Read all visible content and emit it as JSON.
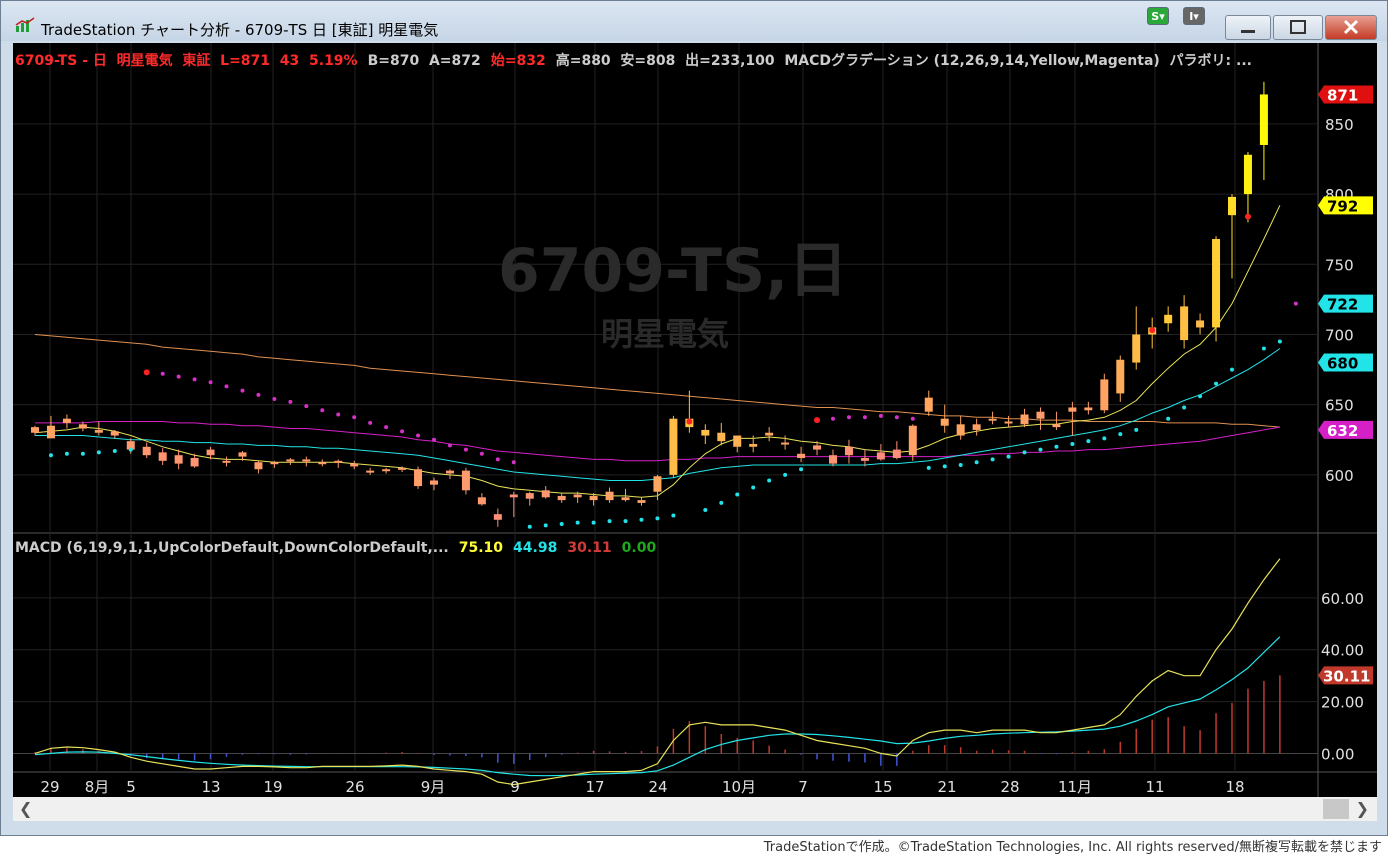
{
  "window": {
    "title": "TradeStation チャート分析 - 6709-TS 日 [東証] 明星電気",
    "s_button": "S",
    "i_button": "I",
    "copyright": "TradeStationで作成。©TradeStation Technologies, Inc. All rights reserved/無断複写転載を禁じます"
  },
  "header": {
    "symbol_info": "6709-TS - 日  明星電気  東証  L=871  43  5.19%",
    "ba_info": "B=870  A=872",
    "open_info": "始=832",
    "hl_info": "高=880  安=808  出=233,100  MACDグラデーション (12,26,9,14,Yellow,Magenta)  パラボリ: ..."
  },
  "watermark": {
    "symbol": "6709-TS,日",
    "name": "明星電気"
  },
  "macd_header": {
    "label": "MACD (6,19,9,1,1,UpColorDefault,DownColorDefault,...",
    "v1": "75.10",
    "v2": "44.98",
    "v3": "30.11",
    "v4": "0.00"
  },
  "colors": {
    "up": "#ffff00",
    "down": "#ff3bd4",
    "signal": "#22e3e8",
    "macd": "#e8e35a",
    "ma_long": "#e09050",
    "ma_mid": "#d520c8",
    "sar": "#22e3e8",
    "sar_red": "#ff2222"
  },
  "chart_data": [
    {
      "type": "candlestick",
      "ylim": [
        560,
        882
      ],
      "y_ticks": [
        600,
        650,
        700,
        750,
        800,
        850
      ],
      "x_labels": [
        "29",
        "8月",
        "5",
        "13",
        "19",
        "26",
        "9月",
        "9",
        "17",
        "24",
        "10月",
        "7",
        "15",
        "21",
        "28",
        "11月",
        "11",
        "18"
      ],
      "price_tags": [
        {
          "value": 871,
          "label": "871"
        },
        {
          "value": 792,
          "label": "792"
        },
        {
          "value": 722,
          "label": "722"
        },
        {
          "value": 680,
          "label": "680"
        },
        {
          "value": 632,
          "label": "632"
        }
      ],
      "candles": [
        [
          630,
          635,
          628,
          634
        ],
        [
          635,
          642,
          628,
          626
        ],
        [
          637,
          643,
          633,
          640
        ],
        [
          636,
          638,
          631,
          633
        ],
        [
          632,
          638,
          628,
          630
        ],
        [
          628,
          632,
          626,
          631
        ],
        [
          624,
          626,
          615,
          618
        ],
        [
          620,
          623,
          612,
          614
        ],
        [
          616,
          619,
          607,
          610
        ],
        [
          614,
          618,
          604,
          608
        ],
        [
          612,
          615,
          605,
          606
        ],
        [
          614,
          620,
          611,
          618
        ],
        [
          610,
          613,
          606,
          609
        ],
        [
          613,
          617,
          610,
          616
        ],
        [
          609,
          610,
          601,
          604
        ],
        [
          608,
          610,
          605,
          609
        ],
        [
          611,
          612,
          607,
          610
        ],
        [
          610,
          613,
          606,
          611
        ],
        [
          609,
          611,
          606,
          608
        ],
        [
          609,
          611,
          605,
          610
        ],
        [
          608,
          610,
          604,
          606
        ],
        [
          603,
          605,
          600,
          602
        ],
        [
          604,
          605,
          601,
          603
        ],
        [
          604,
          606,
          602,
          605
        ],
        [
          604,
          606,
          590,
          592
        ],
        [
          596,
          598,
          589,
          593
        ],
        [
          601,
          604,
          597,
          603
        ],
        [
          603,
          605,
          586,
          589
        ],
        [
          584,
          587,
          578,
          579
        ],
        [
          572,
          576,
          563,
          568
        ],
        [
          584,
          588,
          570,
          586
        ],
        [
          583,
          588,
          578,
          587
        ],
        [
          589,
          592,
          583,
          584
        ],
        [
          585,
          587,
          580,
          582
        ],
        [
          584,
          588,
          580,
          586
        ],
        [
          582,
          587,
          578,
          585
        ],
        [
          588,
          591,
          580,
          582
        ],
        [
          584,
          590,
          581,
          582
        ],
        [
          580,
          584,
          578,
          582
        ],
        [
          588,
          600,
          582,
          599
        ],
        [
          600,
          642,
          598,
          640
        ],
        [
          640,
          660,
          630,
          634
        ],
        [
          628,
          636,
          622,
          632
        ],
        [
          630,
          637,
          621,
          624
        ],
        [
          620,
          628,
          616,
          628
        ],
        [
          622,
          628,
          616,
          620
        ],
        [
          628,
          634,
          624,
          630
        ],
        [
          623,
          628,
          618,
          622
        ],
        [
          615,
          620,
          609,
          612
        ],
        [
          621,
          624,
          614,
          618
        ],
        [
          614,
          618,
          606,
          608
        ],
        [
          620,
          625,
          608,
          614
        ],
        [
          612,
          618,
          606,
          610
        ],
        [
          616,
          622,
          610,
          611
        ],
        [
          618,
          624,
          611,
          612
        ],
        [
          614,
          636,
          610,
          635
        ],
        [
          655,
          660,
          642,
          645
        ],
        [
          640,
          650,
          630,
          635
        ],
        [
          628,
          642,
          625,
          636
        ],
        [
          636,
          640,
          628,
          632
        ],
        [
          640,
          645,
          636,
          640
        ],
        [
          638,
          642,
          634,
          638
        ],
        [
          643,
          647,
          634,
          636
        ],
        [
          640,
          648,
          632,
          645
        ],
        [
          636,
          645,
          632,
          634
        ],
        [
          645,
          652,
          628,
          648
        ],
        [
          646,
          652,
          643,
          648
        ],
        [
          646,
          672,
          644,
          668
        ],
        [
          658,
          685,
          652,
          682
        ],
        [
          680,
          720,
          675,
          700
        ],
        [
          700,
          712,
          690,
          705
        ],
        [
          708,
          720,
          702,
          714
        ],
        [
          720,
          728,
          690,
          696
        ],
        [
          705,
          715,
          700,
          710
        ],
        [
          705,
          770,
          695,
          768
        ],
        [
          785,
          800,
          740,
          798
        ],
        [
          800,
          830,
          780,
          828
        ],
        [
          835,
          880,
          810,
          871
        ]
      ],
      "sar": [
        [
          1,
          614
        ],
        [
          2,
          615
        ],
        [
          3,
          615
        ],
        [
          4,
          616
        ],
        [
          5,
          617
        ],
        [
          6,
          618
        ],
        [
          7,
          673
        ],
        [
          8,
          672
        ],
        [
          9,
          670
        ],
        [
          10,
          668
        ],
        [
          11,
          666
        ],
        [
          12,
          663
        ],
        [
          13,
          660
        ],
        [
          14,
          657
        ],
        [
          15,
          654
        ],
        [
          16,
          652
        ],
        [
          17,
          649
        ],
        [
          18,
          646
        ],
        [
          19,
          643
        ],
        [
          20,
          641
        ],
        [
          21,
          637
        ],
        [
          22,
          634
        ],
        [
          23,
          631
        ],
        [
          24,
          628
        ],
        [
          25,
          625
        ],
        [
          26,
          621
        ],
        [
          27,
          618
        ],
        [
          28,
          615
        ],
        [
          29,
          611
        ],
        [
          30,
          609
        ],
        [
          31,
          563
        ],
        [
          32,
          564
        ],
        [
          33,
          565
        ],
        [
          34,
          566
        ],
        [
          35,
          566
        ],
        [
          36,
          567
        ],
        [
          37,
          567
        ],
        [
          38,
          568
        ],
        [
          39,
          569
        ],
        [
          40,
          571
        ],
        [
          41,
          638
        ],
        [
          42,
          575
        ],
        [
          43,
          580
        ],
        [
          44,
          586
        ],
        [
          45,
          591
        ],
        [
          46,
          596
        ],
        [
          47,
          600
        ],
        [
          48,
          604
        ],
        [
          49,
          639
        ],
        [
          50,
          640
        ],
        [
          51,
          641
        ],
        [
          52,
          641
        ],
        [
          53,
          642
        ],
        [
          54,
          641
        ],
        [
          55,
          640
        ],
        [
          56,
          605
        ],
        [
          57,
          606
        ],
        [
          58,
          607
        ],
        [
          59,
          609
        ],
        [
          60,
          611
        ],
        [
          61,
          613
        ],
        [
          62,
          616
        ],
        [
          63,
          618
        ],
        [
          64,
          620
        ],
        [
          65,
          622
        ],
        [
          66,
          624
        ],
        [
          67,
          626
        ],
        [
          68,
          629
        ],
        [
          69,
          632
        ],
        [
          70,
          703
        ],
        [
          71,
          640
        ],
        [
          72,
          648
        ],
        [
          73,
          656
        ],
        [
          74,
          665
        ],
        [
          75,
          675
        ],
        [
          76,
          784
        ],
        [
          77,
          690
        ],
        [
          78,
          695
        ],
        [
          79,
          722
        ]
      ],
      "ma_short": [
        630,
        631,
        632,
        634,
        633,
        631,
        628,
        624,
        620,
        617,
        614,
        612,
        611,
        611,
        610,
        609,
        609,
        609,
        609,
        609,
        608,
        607,
        606,
        605,
        603,
        601,
        600,
        599,
        596,
        592,
        590,
        589,
        588,
        587,
        587,
        586,
        585,
        585,
        584,
        585,
        593,
        605,
        615,
        622,
        626,
        626,
        627,
        626,
        624,
        623,
        621,
        620,
        618,
        617,
        616,
        617,
        621,
        626,
        629,
        631,
        633,
        634,
        635,
        636,
        636,
        638,
        639,
        641,
        646,
        653,
        665,
        676,
        686,
        693,
        705,
        722,
        745,
        768,
        792
      ],
      "ma_signal": [
        628,
        628,
        628,
        628,
        627,
        626,
        625,
        625,
        624,
        624,
        623,
        623,
        622,
        622,
        621,
        621,
        620,
        620,
        619,
        619,
        618,
        617,
        616,
        615,
        614,
        612,
        610,
        608,
        606,
        604,
        602,
        601,
        600,
        599,
        598,
        597,
        596,
        596,
        596,
        597,
        598,
        601,
        603,
        605,
        606,
        607,
        607,
        607,
        607,
        607,
        607,
        607,
        607,
        608,
        608,
        609,
        610,
        612,
        614,
        616,
        618,
        620,
        622,
        624,
        626,
        628,
        630,
        632,
        635,
        639,
        644,
        648,
        653,
        657,
        663,
        669,
        675,
        682,
        690
      ],
      "ma_mid": [
        637,
        637,
        637,
        637,
        638,
        638,
        638,
        638,
        638,
        637,
        637,
        636,
        636,
        635,
        635,
        634,
        633,
        633,
        632,
        631,
        630,
        629,
        628,
        627,
        625,
        624,
        622,
        621,
        619,
        617,
        616,
        615,
        614,
        613,
        612,
        611,
        611,
        610,
        610,
        610,
        611,
        611,
        612,
        612,
        613,
        613,
        613,
        613,
        613,
        613,
        613,
        613,
        613,
        613,
        613,
        613,
        613,
        613,
        614,
        614,
        615,
        615,
        616,
        616,
        617,
        617,
        618,
        618,
        619,
        620,
        621,
        622,
        623,
        624,
        626,
        628,
        630,
        632,
        634
      ],
      "ma_long": [
        700,
        699,
        698,
        697,
        696,
        695,
        694,
        693,
        691,
        690,
        689,
        688,
        687,
        686,
        684,
        683,
        682,
        681,
        680,
        679,
        678,
        676,
        675,
        674,
        673,
        672,
        671,
        670,
        669,
        668,
        667,
        666,
        665,
        664,
        663,
        662,
        661,
        660,
        659,
        658,
        657,
        656,
        655,
        654,
        653,
        652,
        651,
        650,
        649,
        648,
        648,
        647,
        646,
        645,
        645,
        644,
        643,
        642,
        642,
        641,
        641,
        640,
        640,
        639,
        639,
        639,
        638,
        638,
        638,
        638,
        638,
        637,
        637,
        637,
        637,
        636,
        636,
        635,
        634
      ]
    },
    {
      "type": "macd",
      "ylim": [
        -6,
        75
      ],
      "y_ticks": [
        0,
        20,
        40,
        60
      ],
      "y_tick_labels": [
        "0.00",
        "20.00",
        "40.00",
        "60.00"
      ],
      "price_tag": {
        "value": 30.11,
        "label": "30.11"
      },
      "macd": [
        0,
        2,
        2.5,
        2.2,
        1.5,
        0.5,
        -1.5,
        -3,
        -4,
        -5,
        -6,
        -6,
        -5.5,
        -5,
        -5,
        -5.2,
        -5.5,
        -5.5,
        -5,
        -5,
        -5,
        -5,
        -4.8,
        -4.5,
        -5,
        -6,
        -6.5,
        -7,
        -8,
        -11,
        -12,
        -11,
        -10,
        -9,
        -8,
        -7,
        -7,
        -7,
        -6.5,
        -4,
        5,
        11,
        12,
        11,
        11,
        11,
        10,
        9,
        7,
        5,
        4,
        3,
        2,
        0,
        -1,
        5,
        8,
        9,
        9,
        8,
        9,
        9,
        9,
        8,
        8,
        9,
        10,
        11,
        15,
        22,
        28,
        32,
        30,
        30,
        40,
        48,
        58,
        67,
        75.1
      ],
      "signal": [
        -0.5,
        0,
        0.5,
        0.6,
        0.5,
        0,
        -0.5,
        -1.2,
        -2,
        -2.7,
        -3.3,
        -3.8,
        -4.2,
        -4.5,
        -4.7,
        -4.9,
        -5,
        -5.1,
        -5.1,
        -5.1,
        -5.1,
        -5.1,
        -5.1,
        -5.1,
        -5.2,
        -5.4,
        -5.7,
        -6,
        -6.5,
        -7.4,
        -8,
        -8.5,
        -8.6,
        -8.5,
        -8.3,
        -8,
        -7.8,
        -7.6,
        -7.4,
        -6.7,
        -4.5,
        -1.5,
        1.5,
        3.5,
        5,
        6,
        7,
        7.5,
        7.5,
        7.3,
        6.8,
        6.2,
        5.5,
        4.8,
        3.8,
        4,
        4.8,
        5.8,
        6.6,
        7,
        7.5,
        7.8,
        8,
        8.2,
        8.3,
        8.6,
        9,
        9.4,
        10.5,
        12.5,
        15,
        18,
        19.5,
        21,
        24.5,
        28.5,
        33,
        39,
        44.98
      ],
      "histogram": [
        0.5,
        2,
        2,
        1.6,
        1,
        0.5,
        -1,
        -1.8,
        -2,
        -2.3,
        -2.7,
        -2.2,
        -1.3,
        -0.5,
        -0.3,
        -0.3,
        -0.5,
        -0.4,
        0.1,
        0.1,
        0.1,
        0.1,
        0.3,
        0.6,
        0.2,
        -0.6,
        -0.8,
        -1,
        -1.5,
        -3.6,
        -4,
        -2.5,
        -1.4,
        -0.5,
        0.3,
        1,
        0.8,
        0.6,
        0.9,
        2.7,
        9.5,
        12.5,
        10.5,
        7.5,
        6,
        5,
        3,
        1.5,
        -0.5,
        -2.3,
        -2.8,
        -3.2,
        -3.5,
        -4.8,
        -4.8,
        1,
        3.2,
        3.2,
        2.4,
        1,
        1.5,
        1.2,
        1,
        -0.2,
        -0.3,
        0.4,
        1,
        1.6,
        4.5,
        9.5,
        13,
        14,
        10.5,
        9,
        15.5,
        19.5,
        25,
        28,
        30.11
      ]
    }
  ]
}
